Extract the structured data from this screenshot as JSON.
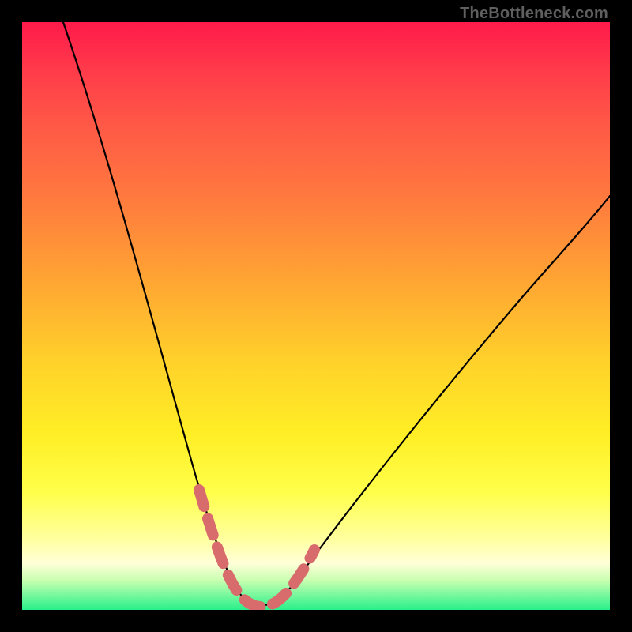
{
  "watermark": {
    "text": "TheBottleneck.com"
  },
  "chart_data": {
    "type": "line",
    "title": "",
    "xlabel": "",
    "ylabel": "",
    "xlim": [
      0,
      100
    ],
    "ylim": [
      0,
      100
    ],
    "grid": false,
    "legend": false,
    "annotations": [
      {
        "text": "TheBottleneck.com",
        "position": "top-right"
      }
    ],
    "series": [
      {
        "name": "bottleneck-curve",
        "x": [
          0,
          5,
          10,
          15,
          20,
          24,
          28,
          31,
          33,
          35,
          37,
          40,
          43,
          46,
          50,
          56,
          63,
          71,
          80,
          90,
          100
        ],
        "values": [
          100,
          82,
          66,
          52,
          40,
          30,
          20,
          12,
          7,
          3,
          1,
          0,
          1,
          4,
          9,
          17,
          27,
          38,
          50,
          62,
          74
        ],
        "color": "#000000"
      },
      {
        "name": "optimal-range-highlight",
        "x": [
          31,
          33,
          35,
          37,
          40,
          43,
          46
        ],
        "values": [
          12,
          7,
          3,
          1,
          0,
          1,
          4
        ],
        "color": "#d86c6c",
        "style": "dashed-thick"
      }
    ]
  }
}
